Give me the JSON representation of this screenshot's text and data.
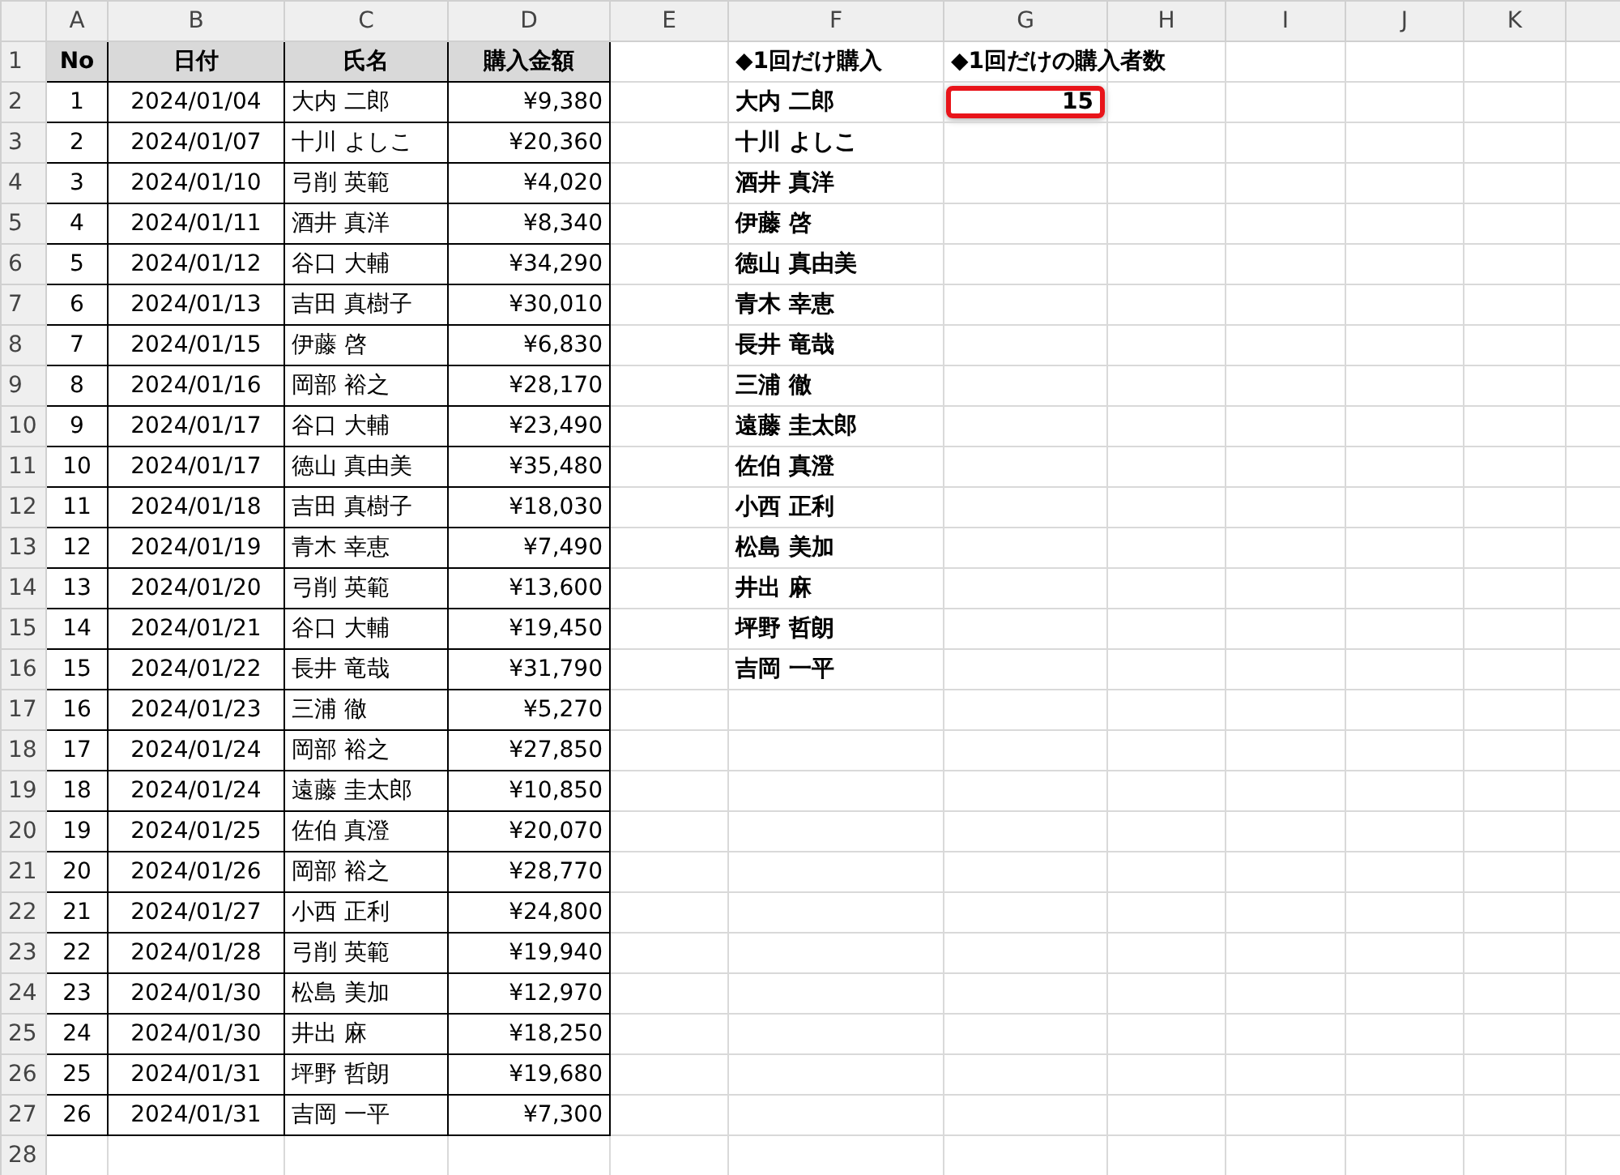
{
  "column_headers": [
    "A",
    "B",
    "C",
    "D",
    "E",
    "F",
    "G",
    "H",
    "I",
    "J",
    "K"
  ],
  "row_numbers": [
    "1",
    "2",
    "3",
    "4",
    "5",
    "6",
    "7",
    "8",
    "9",
    "10",
    "11",
    "12",
    "13",
    "14",
    "15",
    "16",
    "17",
    "18",
    "19",
    "20",
    "21",
    "22",
    "23",
    "24",
    "25",
    "26",
    "27",
    "28"
  ],
  "purchases": {
    "columns": [
      "No",
      "日付",
      "氏名",
      "購入金額"
    ],
    "rows": [
      [
        "1",
        "2024/01/04",
        "大内 二郎",
        "¥9,380"
      ],
      [
        "2",
        "2024/01/07",
        "十川 よしこ",
        "¥20,360"
      ],
      [
        "3",
        "2024/01/10",
        "弓削 英範",
        "¥4,020"
      ],
      [
        "4",
        "2024/01/11",
        "酒井 真洋",
        "¥8,340"
      ],
      [
        "5",
        "2024/01/12",
        "谷口 大輔",
        "¥34,290"
      ],
      [
        "6",
        "2024/01/13",
        "吉田 真樹子",
        "¥30,010"
      ],
      [
        "7",
        "2024/01/15",
        "伊藤 啓",
        "¥6,830"
      ],
      [
        "8",
        "2024/01/16",
        "岡部 裕之",
        "¥28,170"
      ],
      [
        "9",
        "2024/01/17",
        "谷口 大輔",
        "¥23,490"
      ],
      [
        "10",
        "2024/01/17",
        "徳山 真由美",
        "¥35,480"
      ],
      [
        "11",
        "2024/01/18",
        "吉田 真樹子",
        "¥18,030"
      ],
      [
        "12",
        "2024/01/19",
        "青木 幸恵",
        "¥7,490"
      ],
      [
        "13",
        "2024/01/20",
        "弓削 英範",
        "¥13,600"
      ],
      [
        "14",
        "2024/01/21",
        "谷口 大輔",
        "¥19,450"
      ],
      [
        "15",
        "2024/01/22",
        "長井 竜哉",
        "¥31,790"
      ],
      [
        "16",
        "2024/01/23",
        "三浦 徹",
        "¥5,270"
      ],
      [
        "17",
        "2024/01/24",
        "岡部 裕之",
        "¥27,850"
      ],
      [
        "18",
        "2024/01/24",
        "遠藤 圭太郎",
        "¥10,850"
      ],
      [
        "19",
        "2024/01/25",
        "佐伯 真澄",
        "¥20,070"
      ],
      [
        "20",
        "2024/01/26",
        "岡部 裕之",
        "¥28,770"
      ],
      [
        "21",
        "2024/01/27",
        "小西 正利",
        "¥24,800"
      ],
      [
        "22",
        "2024/01/28",
        "弓削 英範",
        "¥19,940"
      ],
      [
        "23",
        "2024/01/30",
        "松島 美加",
        "¥12,970"
      ],
      [
        "24",
        "2024/01/30",
        "井出 麻",
        "¥18,250"
      ],
      [
        "25",
        "2024/01/31",
        "坪野 哲朗",
        "¥19,680"
      ],
      [
        "26",
        "2024/01/31",
        "吉岡 一平",
        "¥7,300"
      ]
    ]
  },
  "single_purchase": {
    "heading": "◆1回だけ購入",
    "names": [
      "大内 二郎",
      "十川 よしこ",
      "酒井 真洋",
      "伊藤 啓",
      "徳山 真由美",
      "青木 幸恵",
      "長井 竜哉",
      "三浦 徹",
      "遠藤 圭太郎",
      "佐伯 真澄",
      "小西 正利",
      "松島 美加",
      "井出 麻",
      "坪野 哲朗",
      "吉岡 一平"
    ]
  },
  "count": {
    "heading": "◆1回だけの購入者数",
    "value": "15",
    "highlighted": true
  }
}
